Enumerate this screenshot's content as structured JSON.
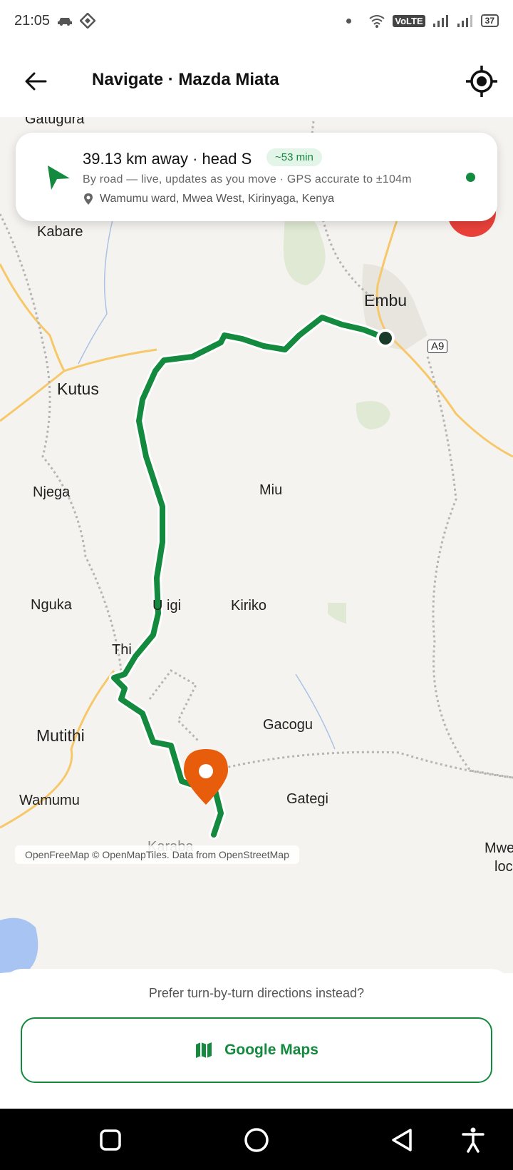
{
  "status_bar": {
    "time": "21:05",
    "volte": "VoLTE",
    "battery": "37"
  },
  "app_bar": {
    "title": "Navigate · Mazda Miata",
    "back_icon": "arrow-left-icon",
    "locate_icon": "gps-crosshair-icon"
  },
  "info_card": {
    "distance": "39.13 km away · head S",
    "eta": "~53 min",
    "subline": "By road — live, updates as you move · GPS accurate to ±104m",
    "place": "Wamumu ward, Mwea West, Kirinyaga, Kenya"
  },
  "map": {
    "labels": {
      "gatugura": "Gatugura",
      "kabare": "Kabare",
      "embu": "Embu",
      "a9": "A9",
      "kutus": "Kutus",
      "njega": "Njega",
      "miu": "Miu",
      "nguka": "Nguka",
      "ugigi": "U igi",
      "kiriko": "Kiriko",
      "thiba": "Thi",
      "mutithi": "Mutithi",
      "gacogu": "Gacogu",
      "wamumu": "Wamumu",
      "gategi": "Gategi",
      "karaba": "Karaba",
      "mwea1": "Mwe",
      "mwea2": "loc"
    },
    "attribution": "OpenFreeMap © OpenMapTiles. Data from OpenStreetMap",
    "route_color": "#138a3e",
    "destination_pin_color": "#e85d0c"
  },
  "bottom_sheet": {
    "prompt": "Prefer turn-by-turn directions instead?",
    "button_label": "Google Maps"
  },
  "colors": {
    "accent": "#138a3e",
    "card_bg": "#ffffff",
    "map_bg": "#f5f3ef"
  }
}
